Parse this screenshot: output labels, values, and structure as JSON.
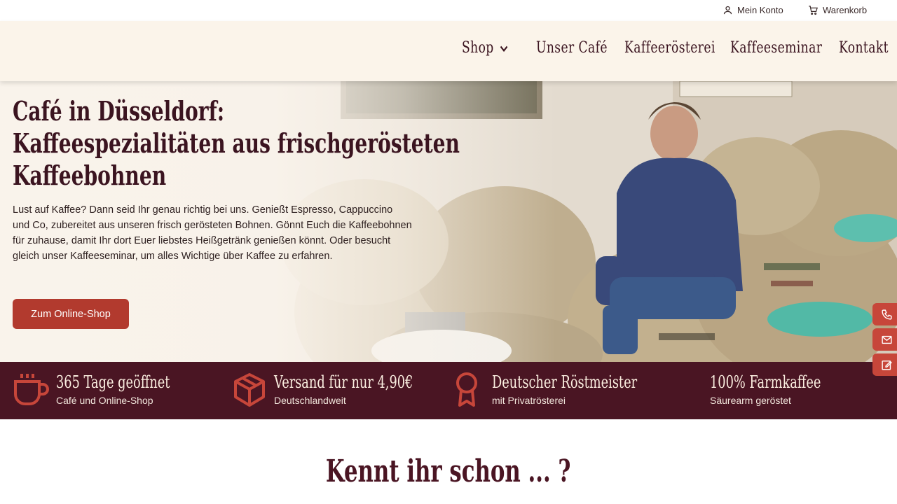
{
  "topbar": {
    "account_label": "Mein Konto",
    "cart_label": "Warenkorb"
  },
  "nav": {
    "items": [
      {
        "label": "Shop",
        "has_dropdown": true
      },
      {
        "label": "Unser Café"
      },
      {
        "label": "Kaffeerösterei"
      },
      {
        "label": "Kaffeeseminar"
      },
      {
        "label": "Kontakt"
      }
    ]
  },
  "hero": {
    "title_lines": [
      "Café in Düsseldorf:",
      "Kaffeespezialitäten aus frischgerösteten",
      "Kaffeebohnen"
    ],
    "text": "Lust auf Kaffee? Dann seid Ihr genau richtig bei uns. Genießt Espresso, Cappuccino und Co, zubereitet aus unseren frisch gerösteten Bohnen. Gönnt Euch die Kaffeebohnen für zuhause, damit Ihr dort Euer liebstes Heißgetränk genießen könnt. Oder besucht gleich unser Kaffeeseminar, um alles Wichtige über Kaffee zu erfahren.",
    "button_label": "Zum Online-Shop"
  },
  "features": [
    {
      "icon": "coffee-cup-icon",
      "title": "365 Tage geöffnet",
      "subtitle": "Café und Online-Shop"
    },
    {
      "icon": "package-box-icon",
      "title": "Versand für nur 4,90€",
      "subtitle": "Deutschlandweit"
    },
    {
      "icon": "award-ribbon-icon",
      "title": "Deutscher Röstmeister",
      "subtitle": "mit Privatrösterei"
    },
    {
      "icon": "",
      "title": "100% Farmkaffee",
      "subtitle": "Säurearm geröstet"
    }
  ],
  "section": {
    "title": "Kennt ihr schon ... ?"
  },
  "side_buttons": [
    "phone-icon",
    "mail-icon",
    "edit-form-icon"
  ],
  "colors": {
    "brand_dark": "#4a1523",
    "accent_red": "#b23a2e",
    "nav_bg": "#fbf4ea",
    "icon_accent": "#c7463a"
  }
}
